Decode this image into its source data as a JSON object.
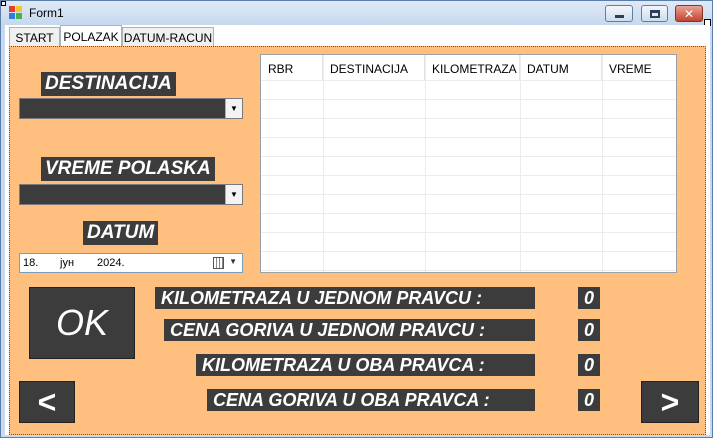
{
  "window": {
    "title": "Form1"
  },
  "tabs": [
    {
      "label": "START"
    },
    {
      "label": "POLAZAK"
    },
    {
      "label": "DATUM-RACUN"
    }
  ],
  "form": {
    "destinacija_label": "DESTINACIJA",
    "destinacija_value": "",
    "vreme_label": "VREME POLASKA",
    "vreme_value": "",
    "datum_label": "DATUM",
    "date": {
      "day": "18.",
      "month": "јун",
      "year": "2024."
    }
  },
  "grid": {
    "columns": [
      "RBR",
      "DESTINACIJA",
      "KILOMETRAZA",
      "DATUM",
      "VREME"
    ],
    "rows": []
  },
  "buttons": {
    "ok": "OK",
    "prev": "<",
    "next": ">"
  },
  "results": [
    {
      "label": "KILOMETRAZA U JEDNOM PRAVCU  :",
      "value": "0"
    },
    {
      "label": "CENA GORIVA U JEDNOM PRAVCU :",
      "value": "0"
    },
    {
      "label": "KILOMETRAZA U OBA PRAVCA  :",
      "value": "0"
    },
    {
      "label": "CENA GORIVA U OBA PRAVCA :",
      "value": "0"
    }
  ],
  "icons": [
    "app-icon",
    "minimize-icon",
    "maximize-icon",
    "close-icon",
    "dropdown-arrow-icon",
    "calendar-icon"
  ],
  "colors": {
    "panel": "#ffc07f",
    "label_bg": "#3c3c3c",
    "label_text": "#ffffff"
  }
}
